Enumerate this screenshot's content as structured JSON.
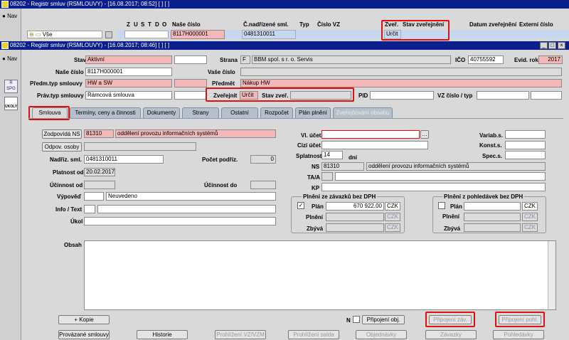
{
  "top_window": {
    "title": "08202 - Registr smluv (RSMLOUVY) - [16.08.2017; 08:52] [ ] [ ]",
    "nav": "Nav",
    "tree_label": "Vše",
    "col_letters": [
      "Z",
      "U",
      "S",
      "T",
      "D",
      "O"
    ],
    "headers": {
      "nase_cislo": "Naše číslo",
      "c_nadrizene": "Č.nadřízené sml.",
      "typ": "Typ",
      "cislo_vz": "Číslo VZ",
      "zver": "Zveř.",
      "stav_zver": "Stav zveřejnění",
      "datum_zver": "Datum zveřejnění",
      "externi": "Externí číslo"
    },
    "row": {
      "nase_cislo": "8117H000001",
      "c_nadrizene": "0481310011",
      "zver": "Určit"
    }
  },
  "main_window": {
    "title": "08202 - Registr smluv (RSMLOUVY) - [16.08.2017; 08:46] [ ] [ ]",
    "nav": "Nav",
    "side_icons": [
      "R SPG",
      "ÚKOLY"
    ]
  },
  "form": {
    "stav_label": "Stav",
    "stav": "Aktivní",
    "strana_label": "Strana",
    "strana_code": "F",
    "strana": "BBM spol. s r. o. Servis",
    "ico_label": "IČO",
    "ico": "40755592",
    "evid_rok_label": "Evid. rok",
    "evid_rok": "2017",
    "nase_cislo_label": "Naše číslo",
    "nase_cislo": "8117H000001",
    "vase_cislo_label": "Vaše číslo",
    "predm_typ_label": "Předm.typ smlouvy",
    "predm_typ": "HW a SW",
    "predmet_label": "Předmět",
    "predmet": "Nákup HW",
    "prav_typ_label": "Práv.typ smlouvy",
    "prav_typ": "Rámcová smlouva",
    "zverejnit_label": "Zveřejnit",
    "zverejnit": "Určit",
    "stav_zver_label": "Stav zveř.",
    "pid_label": "PID",
    "vz_label": "VZ číslo / typ"
  },
  "tabs": [
    "Smlouva",
    "Termíny, ceny a činnosti",
    "Dokumenty",
    "Strany",
    "Ostatní",
    "Rozpočet",
    "Plán plnění",
    "Zveřejňování obsahu"
  ],
  "tab_detail": {
    "zodpovida_btn": "Zodpovídá NS",
    "zodp_code": "81310",
    "zodp_name": "oddělení provozu informačních systémů",
    "odpov_btn": "Odpov. osoby",
    "nadriz_label": "Nadřiz. sml.",
    "nadriz": "0481310011",
    "pocet_label": "Počet podříz.",
    "pocet": "0",
    "platnost_label": "Platnost od",
    "platnost": "20.02.2017",
    "ucinnost_od_label": "Účinnost od",
    "ucinnost_do_label": "Účinnost do",
    "vypoved_label": "Výpověď",
    "vypoved": "Neuvedeno",
    "info_label": "Info / Text",
    "ukol_label": "Úkol",
    "vl_ucet_label": "Vl. účet",
    "cizi_ucet_label": "Cizí účet",
    "splatnost_label": "Splatnost",
    "splatnost": "14",
    "dni": "dní",
    "ns_label": "NS",
    "ns_code": "81310",
    "ns_name": "oddělení provozu informačních systémů",
    "taa_label": "TA/A",
    "kp_label": "KP",
    "variab_label": "Variab.s.",
    "konst_label": "Konst.s.",
    "spec_label": "Spec.s.",
    "plneni_zav_title": "Plnění ze závazků bez DPH",
    "plneni_pohl_title": "Plnění z pohledávek bez DPH",
    "plan_label": "Plán",
    "plneni_label": "Plnění",
    "zbyva_label": "Zbývá",
    "plan_zav": "670 922.00",
    "czk": "CZK",
    "obsah_label": "Obsah",
    "n_label": "N",
    "kopie_btn": "+ Kopie",
    "pripojeni_obj_btn": "Připojení obj.",
    "pripojeni_zav_btn": "Připojení záv.",
    "pripojeni_pohl_btn": "Připojení pohl.",
    "bottom_buttons": [
      "Provázané smlouvy",
      "Historie",
      "Prohlížení VZ/VZM",
      "Prohlížení salda",
      "Objednávky",
      "Závazky",
      "Pohledávky"
    ]
  },
  "colors": {
    "title_bg": "#0a1e8c",
    "required_pink": "#f4b8b8",
    "highlight_red": "#e01010"
  }
}
